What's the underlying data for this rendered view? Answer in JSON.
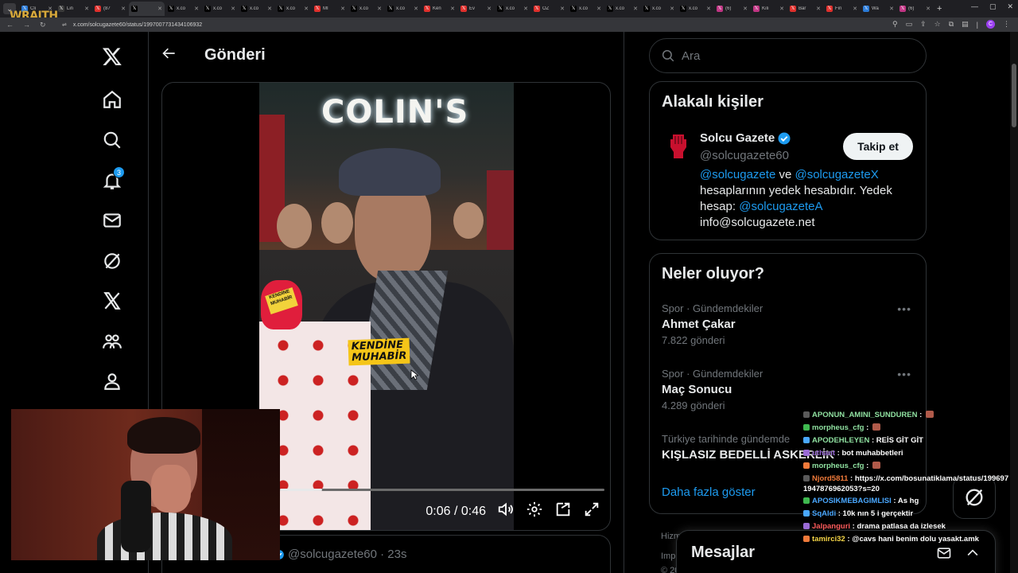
{
  "browser": {
    "tabs": [
      {
        "title": "Cli",
        "color": "#2b7bd8",
        "active": false
      },
      {
        "title": "Lin",
        "color": "#3a3a3a",
        "active": false
      },
      {
        "title": "(87",
        "color": "#e0302c",
        "active": false
      },
      {
        "title": "",
        "color": "#000000",
        "active": true
      },
      {
        "title": "x.co",
        "color": "#000000",
        "active": false
      },
      {
        "title": "x.co",
        "color": "#000000",
        "active": false
      },
      {
        "title": "x.co",
        "color": "#000000",
        "active": false
      },
      {
        "title": "x.co",
        "color": "#000000",
        "active": false
      },
      {
        "title": "Mİ",
        "color": "#e0302c",
        "active": false
      },
      {
        "title": "x.co",
        "color": "#000000",
        "active": false
      },
      {
        "title": "x.co",
        "color": "#000000",
        "active": false
      },
      {
        "title": "Ken",
        "color": "#e0302c",
        "active": false
      },
      {
        "title": "Ev",
        "color": "#e0302c",
        "active": false
      },
      {
        "title": "x.co",
        "color": "#000000",
        "active": false
      },
      {
        "title": "ÖZ",
        "color": "#e0302c",
        "active": false
      },
      {
        "title": "x.co",
        "color": "#000000",
        "active": false
      },
      {
        "title": "x.co",
        "color": "#000000",
        "active": false
      },
      {
        "title": "x.co",
        "color": "#000000",
        "active": false
      },
      {
        "title": "x.co",
        "color": "#000000",
        "active": false
      },
      {
        "title": "(6)",
        "color": "#c13584",
        "active": false
      },
      {
        "title": "Kılı",
        "color": "#c13584",
        "active": false
      },
      {
        "title": "Bar",
        "color": "#e0302c",
        "active": false
      },
      {
        "title": "Fin",
        "color": "#e0302c",
        "active": false
      },
      {
        "title": "Wa",
        "color": "#2b7bd8",
        "active": false
      },
      {
        "title": "(6)",
        "color": "#c13584",
        "active": false
      }
    ],
    "url": "x.com/solcugazete60/status/1997007731434106932",
    "brand_overlay": "WRAITH",
    "profile_initial": "C",
    "window_controls": [
      "—",
      "▢",
      "✕"
    ]
  },
  "nav": {
    "notification_count": "3",
    "items": [
      "x-logo",
      "home",
      "explore",
      "notifications",
      "messages",
      "grok",
      "premium",
      "communities",
      "profile"
    ]
  },
  "main": {
    "title": "Gönderi",
    "video": {
      "store_sign": "COLIN'S",
      "caption_line1": "KENDİNE",
      "caption_line2": "MUHABİR",
      "mic_label": "KENDİNE MUHABİR",
      "time": "0:06 / 0:46",
      "progress_fraction": 0.13
    },
    "next_tweet_handle": "@solcugazete60 · 23s"
  },
  "sidebar": {
    "search_placeholder": "Ara",
    "related": {
      "title": "Alakalı kişiler",
      "name": "Solcu Gazete",
      "handle": "@solcugazete60",
      "follow_label": "Takip et",
      "bio_link1": "@solcugazete",
      "bio_and": "ve",
      "bio_link2": "@solcugazeteX",
      "bio_text": "hesaplarının yedek hesabıdır. Yedek hesap:",
      "bio_link3": "@solcugazeteA",
      "bio_email": "info@solcugazete.net"
    },
    "trends": {
      "title": "Neler oluyor?",
      "items": [
        {
          "meta": "Spor · Gündemdekiler",
          "name": "Ahmet Çakar",
          "count": "7.822 gönderi"
        },
        {
          "meta": "Spor · Gündemdekiler",
          "name": "Maç Sonucu",
          "count": "4.289 gönderi"
        },
        {
          "meta": "Türkiye tarihinde gündemde",
          "name": "KIŞLASIZ BEDELLİ ASKERLİK",
          "count": ""
        }
      ],
      "show_more": "Daha fazla göster"
    },
    "footer1": "Hizm",
    "footer2": "Impr",
    "footer3": "© 20",
    "messages_title": "Mesajlar"
  },
  "chat": [
    {
      "user": "APONUN_AMINI_SUNDUREN",
      "color": "#8fe0a0",
      "text": "",
      "emote": true
    },
    {
      "user": "morpheus_cfg",
      "color": "#8fe0a0",
      "text": "",
      "emote": true
    },
    {
      "user": "APODEHLEYEN",
      "color": "#8fe0a0",
      "text": "REİS GİT GİT",
      "emote": false
    },
    {
      "user": "uthant",
      "color": "#9a6bd6",
      "text": "bot muhabbetleri",
      "emote": false
    },
    {
      "user": "morpheus_cfg",
      "color": "#8fe0a0",
      "text": "",
      "emote": true
    },
    {
      "user": "Njord5811",
      "color": "#f07a3a",
      "text": "https://x.com/bosunatiklama/status/1996971947876962053?s=20",
      "emote": false
    },
    {
      "user": "APOSIKMEBAGIMLISI",
      "color": "#4aa8ff",
      "text": "As hg",
      "emote": false
    },
    {
      "user": "SqAldi",
      "color": "#4aa8ff",
      "text": "10k nın 5 i gerçektir",
      "emote": false
    },
    {
      "user": "Jalpanguri",
      "color": "#ff5c5c",
      "text": "drama patlasa da izlesek",
      "emote": false
    },
    {
      "user": "tamirci32",
      "color": "#f5d547",
      "text": "@cavs hani benim dolu yasakt.amk",
      "emote": false
    }
  ]
}
